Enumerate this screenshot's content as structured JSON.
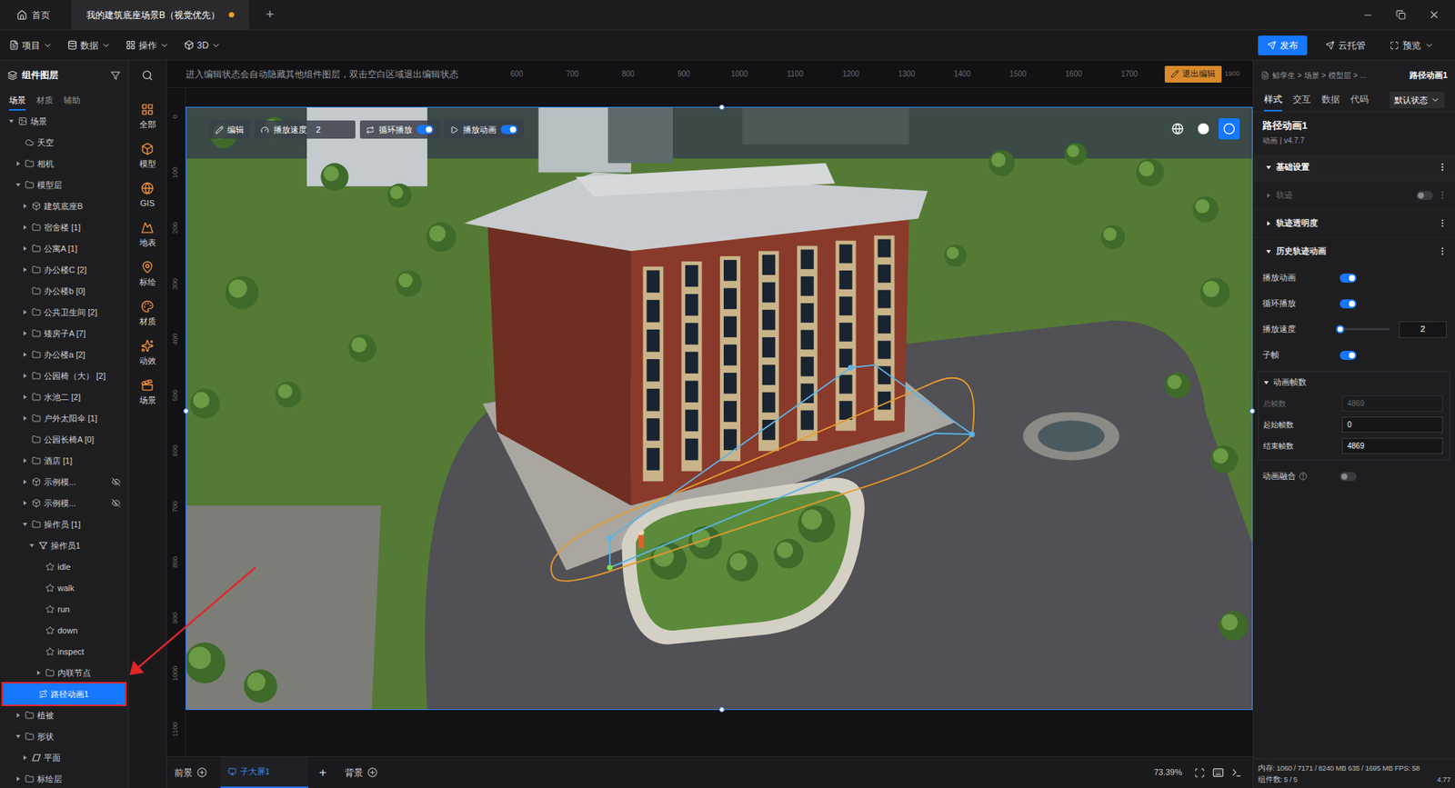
{
  "title_bar": {
    "home": "首页",
    "tabs": [
      {
        "label": "我的建筑底座场景B（视觉优先）",
        "selected": true,
        "unsaved": true
      }
    ],
    "new_tab": "+"
  },
  "menu_bar": {
    "menus": [
      "项目",
      "数据",
      "操作",
      "3D"
    ],
    "actions": [
      {
        "label": "发布",
        "primary": true
      },
      {
        "label": "云托管",
        "primary": false
      },
      {
        "label": "预览",
        "primary": false
      }
    ]
  },
  "layer_panel": {
    "title": "组件图层",
    "tabs": [
      {
        "label": "场景",
        "selected": true
      },
      {
        "label": "材质",
        "selected": false
      },
      {
        "label": "辅助",
        "selected": false
      }
    ],
    "tree": [
      {
        "label": "场景",
        "depth": 0,
        "kind": "scene",
        "expandable": true,
        "expanded": true,
        "selected": false,
        "hidden": false
      },
      {
        "label": "天空",
        "depth": 1,
        "kind": "sky",
        "expandable": false,
        "expanded": false,
        "selected": false,
        "hidden": false
      },
      {
        "label": "相机",
        "depth": 1,
        "kind": "folder",
        "expandable": true,
        "expanded": false,
        "selected": false,
        "hidden": false
      },
      {
        "label": "模型层",
        "depth": 1,
        "kind": "folder",
        "expandable": true,
        "expanded": true,
        "selected": false,
        "hidden": false
      },
      {
        "label": "建筑底座B",
        "depth": 2,
        "kind": "model",
        "expandable": true,
        "expanded": false,
        "selected": false,
        "hidden": false
      },
      {
        "label": "宿舍楼 [1]",
        "depth": 2,
        "kind": "folder",
        "expandable": true,
        "expanded": false,
        "selected": false,
        "hidden": false
      },
      {
        "label": "公寓A [1]",
        "depth": 2,
        "kind": "folder",
        "expandable": true,
        "expanded": false,
        "selected": false,
        "hidden": false
      },
      {
        "label": "办公楼C [2]",
        "depth": 2,
        "kind": "folder",
        "expandable": true,
        "expanded": false,
        "selected": false,
        "hidden": false
      },
      {
        "label": "办公楼b [0]",
        "depth": 2,
        "kind": "folder",
        "expandable": false,
        "expanded": false,
        "selected": false,
        "hidden": false
      },
      {
        "label": "公共卫生间 [2]",
        "depth": 2,
        "kind": "folder",
        "expandable": true,
        "expanded": false,
        "selected": false,
        "hidden": false
      },
      {
        "label": "矮房子A [7]",
        "depth": 2,
        "kind": "folder",
        "expandable": true,
        "expanded": false,
        "selected": false,
        "hidden": false
      },
      {
        "label": "办公楼a [2]",
        "depth": 2,
        "kind": "folder",
        "expandable": true,
        "expanded": false,
        "selected": false,
        "hidden": false
      },
      {
        "label": "公园椅（大） [2]",
        "depth": 2,
        "kind": "folder",
        "expandable": true,
        "expanded": false,
        "selected": false,
        "hidden": false
      },
      {
        "label": "水池二 [2]",
        "depth": 2,
        "kind": "folder",
        "expandable": true,
        "expanded": false,
        "selected": false,
        "hidden": false
      },
      {
        "label": "户外太阳伞 [1]",
        "depth": 2,
        "kind": "folder",
        "expandable": true,
        "expanded": false,
        "selected": false,
        "hidden": false
      },
      {
        "label": "公园长椅A [0]",
        "depth": 2,
        "kind": "folder",
        "expandable": false,
        "expanded": false,
        "selected": false,
        "hidden": false
      },
      {
        "label": "酒店 [1]",
        "depth": 2,
        "kind": "folder",
        "expandable": true,
        "expanded": false,
        "selected": false,
        "hidden": false
      },
      {
        "label": "示例模...",
        "depth": 2,
        "kind": "model",
        "expandable": true,
        "expanded": false,
        "selected": false,
        "hidden": true
      },
      {
        "label": "示例模...",
        "depth": 2,
        "kind": "model",
        "expandable": true,
        "expanded": false,
        "selected": false,
        "hidden": true
      },
      {
        "label": "操作员 [1]",
        "depth": 2,
        "kind": "folder",
        "expandable": true,
        "expanded": true,
        "selected": false,
        "hidden": false
      },
      {
        "label": "操作员1",
        "depth": 3,
        "kind": "operator",
        "expandable": true,
        "expanded": true,
        "selected": false,
        "hidden": false
      },
      {
        "label": "idle",
        "depth": 4,
        "kind": "action",
        "expandable": false,
        "expanded": false,
        "selected": false,
        "hidden": false
      },
      {
        "label": "walk",
        "depth": 4,
        "kind": "action",
        "expandable": false,
        "expanded": false,
        "selected": false,
        "hidden": false
      },
      {
        "label": "run",
        "depth": 4,
        "kind": "action",
        "expandable": false,
        "expanded": false,
        "selected": false,
        "hidden": false
      },
      {
        "label": "down",
        "depth": 4,
        "kind": "action",
        "expandable": false,
        "expanded": false,
        "selected": false,
        "hidden": false
      },
      {
        "label": "inspect",
        "depth": 4,
        "kind": "action",
        "expandable": false,
        "expanded": false,
        "selected": false,
        "hidden": false
      },
      {
        "label": "内联节点",
        "depth": 4,
        "kind": "folder",
        "expandable": true,
        "expanded": false,
        "selected": false,
        "hidden": false
      },
      {
        "label": "路径动画1",
        "depth": 3,
        "kind": "path",
        "expandable": false,
        "expanded": false,
        "selected": true,
        "hidden": false
      },
      {
        "label": "植被",
        "depth": 1,
        "kind": "folder",
        "expandable": true,
        "expanded": false,
        "selected": false,
        "hidden": false
      },
      {
        "label": "形状",
        "depth": 1,
        "kind": "folder",
        "expandable": true,
        "expanded": true,
        "selected": false,
        "hidden": false
      },
      {
        "label": "平面",
        "depth": 2,
        "kind": "plane",
        "expandable": true,
        "expanded": false,
        "selected": false,
        "hidden": false
      },
      {
        "label": "标绘层",
        "depth": 1,
        "kind": "folder",
        "expandable": true,
        "expanded": false,
        "selected": false,
        "hidden": false
      }
    ]
  },
  "component_bar": {
    "items": [
      "全部",
      "模型",
      "GIS",
      "地表",
      "标绘",
      "材质",
      "动效",
      "场景"
    ]
  },
  "canvas": {
    "hint": "进入编辑状态会自动隐藏其他组件图层，双击空白区域退出编辑状态",
    "exit_button": "退出编辑",
    "ruler_x": [
      "600",
      "700",
      "800",
      "900",
      "1000",
      "1100",
      "1200",
      "1300",
      "1400",
      "1500",
      "1600",
      "1700"
    ],
    "ruler_x_end": "1900",
    "ruler_y": [
      "0",
      "100",
      "200",
      "300",
      "400",
      "500",
      "600",
      "700",
      "800",
      "900",
      "1000",
      "1100"
    ],
    "toolbar": {
      "edit": "编辑",
      "speed_label": "播放速度",
      "speed_value": "2",
      "toggles": [
        {
          "label": "循环播放",
          "on": true
        },
        {
          "label": "播放动画",
          "on": true
        }
      ]
    },
    "view_modes": [
      {
        "selected": false
      },
      {
        "selected": false
      },
      {
        "selected": true
      }
    ]
  },
  "bottom_bar": {
    "foreground": "前景",
    "screens": [
      {
        "label": "子大屏1",
        "selected": true
      }
    ],
    "add_screen": "+",
    "background": "背景",
    "zoom": "73.39%"
  },
  "properties": {
    "breadcrumb": [
      "鲸孪生",
      "场景",
      "模型层",
      "..."
    ],
    "separator": ">",
    "current": "路径动画1",
    "tabs": [
      {
        "label": "样式",
        "selected": true
      },
      {
        "label": "交互",
        "selected": false
      },
      {
        "label": "数据",
        "selected": false
      },
      {
        "label": "代码",
        "selected": false
      }
    ],
    "state_select": "默认状态",
    "component": {
      "name": "路径动画1",
      "meta": "动画 | v4.7.7"
    },
    "section": {
      "title": "基础设置",
      "expanded": true
    },
    "groups": [
      {
        "title": "轨迹",
        "expanded": false,
        "disabled": true,
        "toggle": {
          "on": false
        },
        "rows": []
      },
      {
        "title": "轨迹透明度",
        "expanded": false,
        "disabled": false,
        "toggle": null,
        "rows": []
      },
      {
        "title": "历史轨迹动画",
        "expanded": true,
        "disabled": false,
        "toggle": null,
        "rows": [
          {
            "kind": "switch",
            "label": "播放动画",
            "on": true,
            "help": false
          },
          {
            "kind": "switch",
            "label": "循环播放",
            "on": true,
            "help": false
          },
          {
            "kind": "slider",
            "label": "播放速度",
            "level": 0,
            "value": "2"
          },
          {
            "kind": "switch",
            "label": "子帧",
            "on": true,
            "help": false
          },
          {
            "kind": "fieldset",
            "label": "动画帧数",
            "expanded": true,
            "fields": [
              {
                "label": "总帧数",
                "value": "4869",
                "disabled": true
              },
              {
                "label": "起始帧数",
                "value": "0",
                "disabled": false
              },
              {
                "label": "结束帧数",
                "value": "4869",
                "disabled": false
              }
            ]
          },
          {
            "kind": "switch",
            "label": "动画融合",
            "on": false,
            "help": true
          }
        ]
      }
    ]
  },
  "status_bar": {
    "memory": "内存: 1060 / 7171 / 8240 MB 635 / 1695 MB FPS: 58",
    "components": "组件数: 5 / 5",
    "version": "4.77"
  }
}
